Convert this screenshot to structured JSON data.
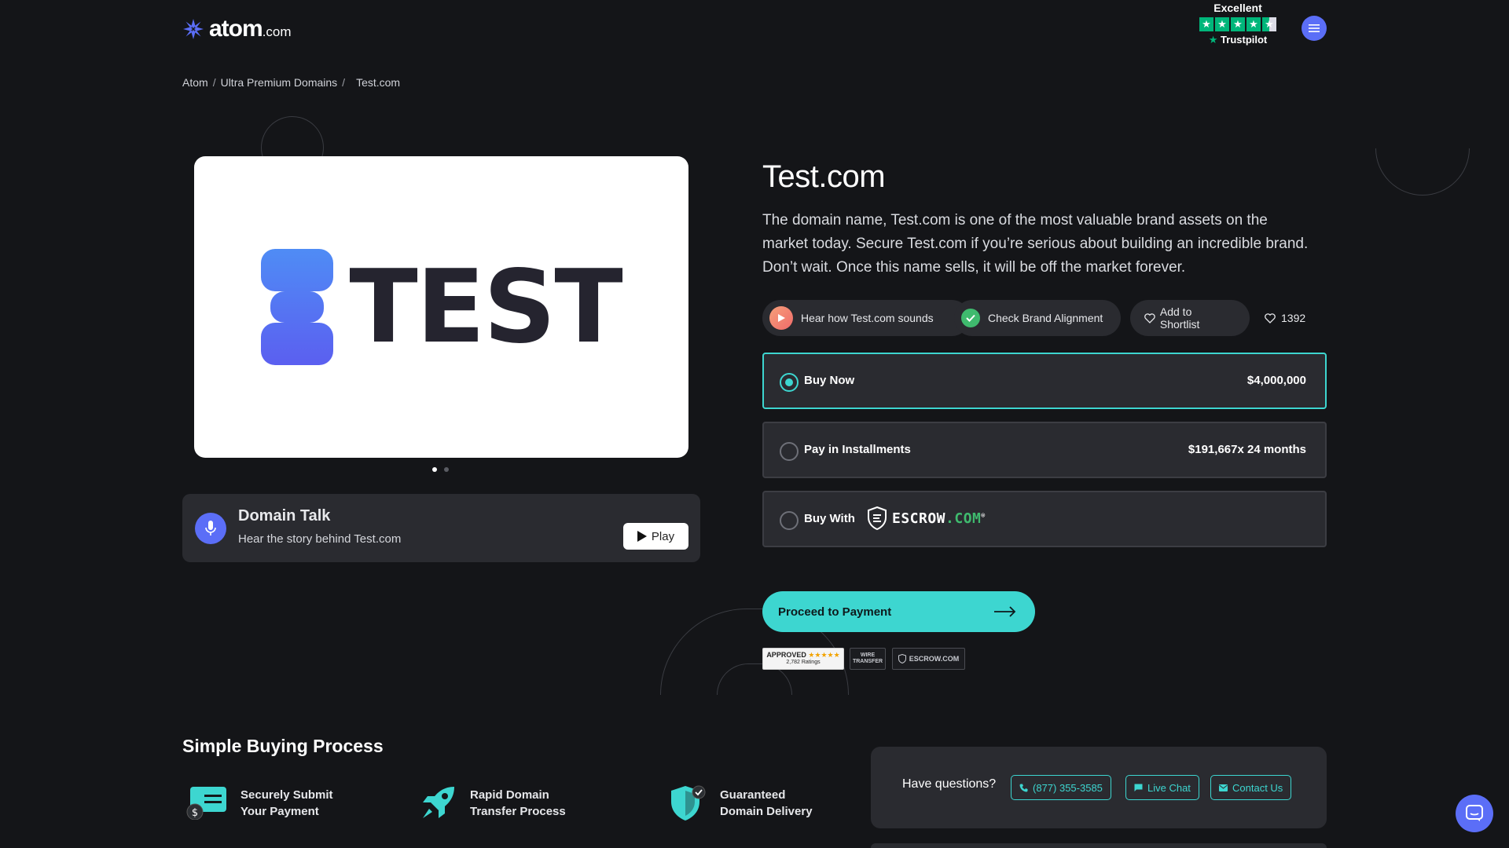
{
  "header": {
    "logo_text": "atom",
    "logo_suffix": ".com",
    "trustpilot_rating": "Excellent",
    "trustpilot_name": "Trustpilot",
    "trustpilot_stars": 4.5
  },
  "breadcrumb": {
    "items": [
      "Atom",
      "Ultra Premium Domains",
      "Test.com"
    ],
    "separator": "/"
  },
  "gallery": {
    "logo_word": "TEST",
    "slide_count": 2,
    "active_slide": 1
  },
  "domain_talk": {
    "title": "Domain Talk",
    "subtitle": "Hear the story behind Test.com",
    "play_label": "Play"
  },
  "domain": {
    "name": "Test.com",
    "description": "The domain name, Test.com is one of the most valuable brand assets on the market today. Secure Test.com if you’re serious about building an incredible brand. Don’t wait. Once this name sells, it will be off the market forever."
  },
  "actions": {
    "hear_label": "Hear how Test.com sounds",
    "brand_label": "Check Brand Alignment",
    "shortlist_label": "Add to Shortlist",
    "likes_count": "1392"
  },
  "purchase_options": {
    "buy_now": {
      "label": "Buy Now",
      "price": "$4,000,000",
      "selected": true
    },
    "installments": {
      "label": "Pay in Installments",
      "price": "$191,667x 24 months",
      "selected": false
    },
    "escrow": {
      "label": "Buy With",
      "brand": "ESCROW",
      "brand_suffix": ".COM",
      "selected": false
    }
  },
  "proceed": {
    "label": "Proceed to Payment"
  },
  "trust_badges": {
    "approved": "APPROVED",
    "ratings": "2,782 Ratings",
    "wire": "WIRE TRANSFER",
    "escrow": "ESCROW.COM"
  },
  "buying_process": {
    "title": "Simple Buying Process",
    "steps": [
      {
        "line1": "Securely Submit",
        "line2": "Your Payment"
      },
      {
        "line1": "Rapid Domain",
        "line2": "Transfer Process"
      },
      {
        "line1": "Guaranteed",
        "line2": "Domain Delivery"
      }
    ]
  },
  "contact": {
    "question": "Have questions?",
    "phone": "(877) 355-3585",
    "chat": "Live Chat",
    "contact": "Contact Us"
  },
  "colors": {
    "background": "#141518",
    "card": "#2a2b30",
    "accent_teal": "#3dd6d0",
    "accent_blue": "#5b6ef7",
    "trustpilot_green": "#00b67a"
  }
}
